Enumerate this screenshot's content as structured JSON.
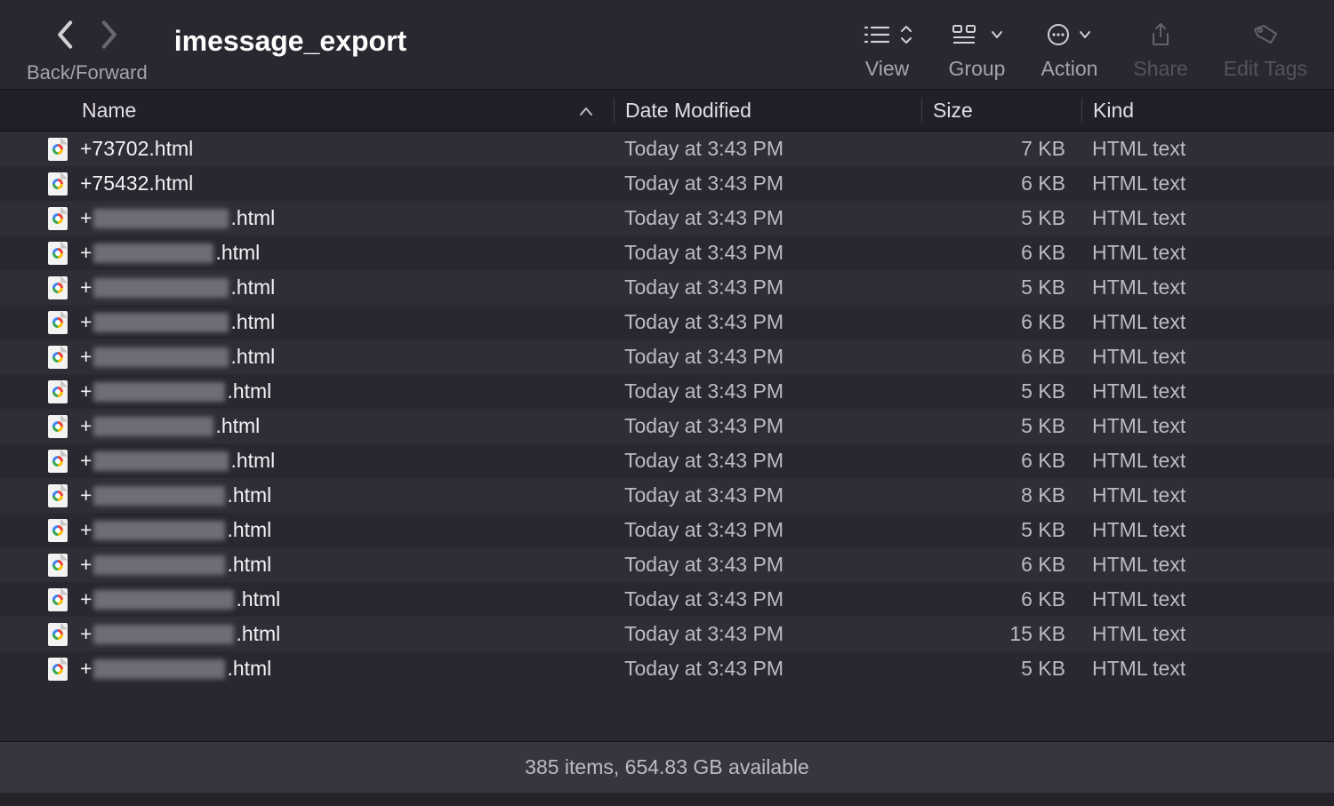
{
  "toolbar": {
    "nav_label": "Back/Forward",
    "title": "imessage_export",
    "view_label": "View",
    "group_label": "Group",
    "action_label": "Action",
    "share_label": "Share",
    "edit_tags_label": "Edit Tags"
  },
  "columns": {
    "name": "Name",
    "date_modified": "Date Modified",
    "size": "Size",
    "kind": "Kind"
  },
  "files": [
    {
      "name_prefix": "+73702",
      "name_redacted": false,
      "blur_width": 0,
      "name_suffix": ".html",
      "date": "Today at 3:43 PM",
      "size": "7 KB",
      "kind": "HTML text"
    },
    {
      "name_prefix": "+75432",
      "name_redacted": false,
      "blur_width": 0,
      "name_suffix": ".html",
      "date": "Today at 3:43 PM",
      "size": "6 KB",
      "kind": "HTML text"
    },
    {
      "name_prefix": "+",
      "name_redacted": true,
      "blur_width": 152,
      "name_suffix": ".html",
      "date": "Today at 3:43 PM",
      "size": "5 KB",
      "kind": "HTML text"
    },
    {
      "name_prefix": "+",
      "name_redacted": true,
      "blur_width": 135,
      "name_suffix": ".html",
      "date": "Today at 3:43 PM",
      "size": "6 KB",
      "kind": "HTML text"
    },
    {
      "name_prefix": "+",
      "name_redacted": true,
      "blur_width": 152,
      "name_suffix": ".html",
      "date": "Today at 3:43 PM",
      "size": "5 KB",
      "kind": "HTML text"
    },
    {
      "name_prefix": "+",
      "name_redacted": true,
      "blur_width": 152,
      "name_suffix": ".html",
      "date": "Today at 3:43 PM",
      "size": "6 KB",
      "kind": "HTML text"
    },
    {
      "name_prefix": "+",
      "name_redacted": true,
      "blur_width": 152,
      "name_suffix": ".html",
      "date": "Today at 3:43 PM",
      "size": "6 KB",
      "kind": "HTML text"
    },
    {
      "name_prefix": "+",
      "name_redacted": true,
      "blur_width": 148,
      "name_suffix": ".html",
      "date": "Today at 3:43 PM",
      "size": "5 KB",
      "kind": "HTML text"
    },
    {
      "name_prefix": "+",
      "name_redacted": true,
      "blur_width": 135,
      "name_suffix": ".html",
      "date": "Today at 3:43 PM",
      "size": "5 KB",
      "kind": "HTML text"
    },
    {
      "name_prefix": "+",
      "name_redacted": true,
      "blur_width": 152,
      "name_suffix": ".html",
      "date": "Today at 3:43 PM",
      "size": "6 KB",
      "kind": "HTML text"
    },
    {
      "name_prefix": "+",
      "name_redacted": true,
      "blur_width": 148,
      "name_suffix": ".html",
      "date": "Today at 3:43 PM",
      "size": "8 KB",
      "kind": "HTML text"
    },
    {
      "name_prefix": "+",
      "name_redacted": true,
      "blur_width": 148,
      "name_suffix": ".html",
      "date": "Today at 3:43 PM",
      "size": "5 KB",
      "kind": "HTML text"
    },
    {
      "name_prefix": "+",
      "name_redacted": true,
      "blur_width": 148,
      "name_suffix": ".html",
      "date": "Today at 3:43 PM",
      "size": "6 KB",
      "kind": "HTML text"
    },
    {
      "name_prefix": "+",
      "name_redacted": true,
      "blur_width": 158,
      "name_suffix": ".html",
      "date": "Today at 3:43 PM",
      "size": "6 KB",
      "kind": "HTML text"
    },
    {
      "name_prefix": "+",
      "name_redacted": true,
      "blur_width": 158,
      "name_suffix": ".html",
      "date": "Today at 3:43 PM",
      "size": "15 KB",
      "kind": "HTML text"
    },
    {
      "name_prefix": "+",
      "name_redacted": true,
      "blur_width": 148,
      "name_suffix": ".html",
      "date": "Today at 3:43 PM",
      "size": "5 KB",
      "kind": "HTML text"
    }
  ],
  "status": "385 items, 654.83 GB available"
}
